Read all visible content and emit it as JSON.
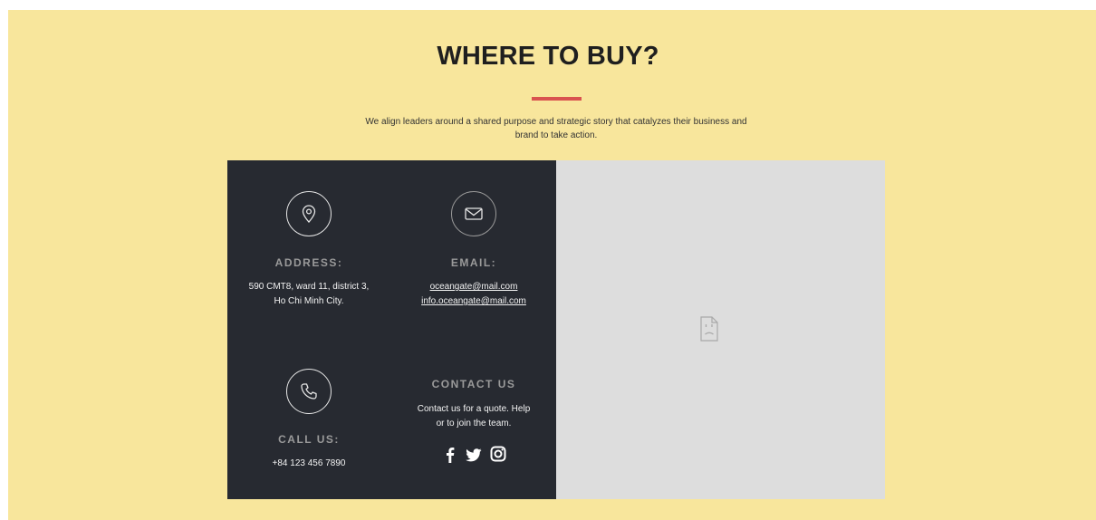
{
  "header": {
    "title": "WHERE TO BUY?",
    "description": "We align leaders around a shared purpose and strategic story that catalyzes their business and brand to take action.",
    "accent_color": "#d9534f"
  },
  "address": {
    "heading": "ADDRESS:",
    "line1": "590 CMT8, ward 11, district 3,",
    "line2": "Ho Chi Minh City.",
    "icon": "location-pin-icon"
  },
  "email": {
    "heading": "EMAIL:",
    "links": [
      "oceangate@mail.com",
      "info.oceangate@mail.com"
    ],
    "icon": "envelope-icon"
  },
  "call": {
    "heading": "CALL US:",
    "phone": "+84 123 456 7890",
    "icon": "phone-icon"
  },
  "contact": {
    "heading": "CONTACT US",
    "line1": "Contact us for a quote. Help",
    "line2": "or to join the team.",
    "social": [
      "facebook-icon",
      "twitter-icon",
      "instagram-icon"
    ]
  },
  "colors": {
    "background": "#f8e69c",
    "panel": "#272a31",
    "map_placeholder": "#dddddd"
  }
}
